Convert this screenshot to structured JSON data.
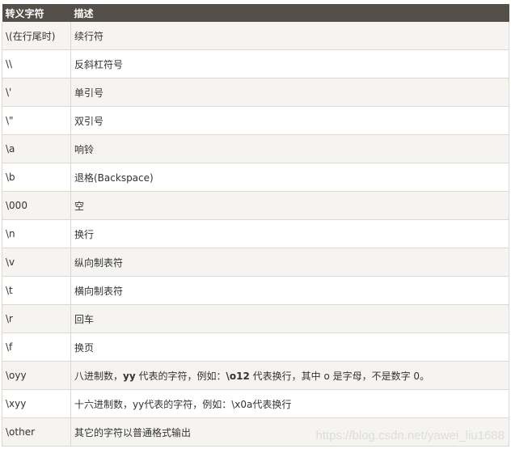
{
  "headers": [
    "转义字符",
    "描述"
  ],
  "rows": [
    {
      "char": "\\(在行尾时)",
      "desc": "续行符"
    },
    {
      "char": "\\\\",
      "desc": "反斜杠符号"
    },
    {
      "char": "\\'",
      "desc": "单引号"
    },
    {
      "char": "\\\"",
      "desc": "双引号"
    },
    {
      "char": "\\a",
      "desc": "响铃"
    },
    {
      "char": "\\b",
      "desc": "退格(Backspace)"
    },
    {
      "char": "\\000",
      "desc": "空"
    },
    {
      "char": "\\n",
      "desc": "换行"
    },
    {
      "char": "\\v",
      "desc": "纵向制表符"
    },
    {
      "char": "\\t",
      "desc": "横向制表符"
    },
    {
      "char": "\\r",
      "desc": "回车"
    },
    {
      "char": "\\f",
      "desc": "换页"
    },
    {
      "char": "\\oyy",
      "desc_parts": [
        "八进制数，",
        "yy",
        " 代表的字符，例如：",
        "\\o12",
        " 代表换行，其中 o 是字母，不是数字 0。"
      ]
    },
    {
      "char": "\\xyy",
      "desc": "十六进制数，yy代表的字符，例如：\\x0a代表换行"
    },
    {
      "char": "\\other",
      "desc": "其它的字符以普通格式输出"
    }
  ],
  "watermark": "https://blog.csdn.net/yawei_liu1688"
}
